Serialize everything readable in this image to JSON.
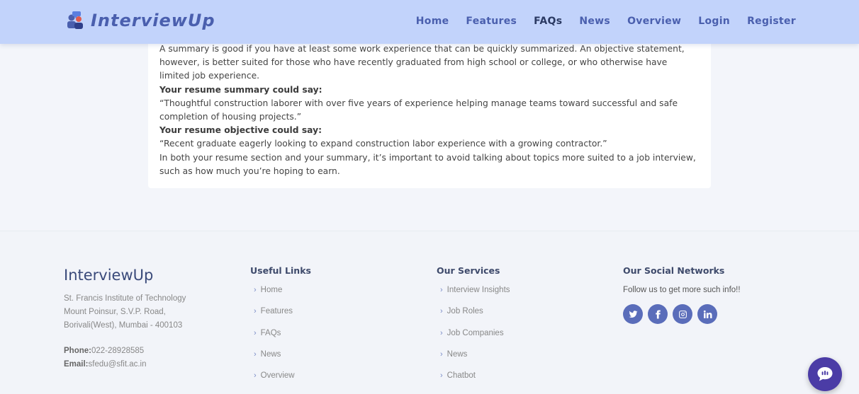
{
  "brand": {
    "name": "InterviewUp"
  },
  "nav": {
    "items": [
      {
        "label": "Home"
      },
      {
        "label": "Features"
      },
      {
        "label": "FAQs"
      },
      {
        "label": "News"
      },
      {
        "label": "Overview"
      },
      {
        "label": "Login"
      },
      {
        "label": "Register"
      }
    ],
    "active": "FAQs"
  },
  "content": {
    "paragraphs": [
      "A summary is good if you have at least some work experience that can be quickly summarized. An objective statement, however, is better suited for those who have recently graduated from high school or college, or who otherwise have limited job experience.",
      "Your resume summary could say:",
      "“Thoughtful construction laborer with over five years of experience helping manage teams toward successful and safe completion of housing projects.”",
      "Your resume objective could say:",
      "“Recent graduate eagerly looking to expand construction labor experience with a growing contractor.”",
      "In both your resume section and your summary, it’s important to avoid talking about topics more suited to a job interview, such as how much you’re hoping to earn."
    ]
  },
  "footer": {
    "brand": "InterviewUp",
    "address": [
      "St. Francis Institute of Technology",
      "Mount Poinsur, S.V.P. Road,",
      "Borivali(West), Mumbai - 400103"
    ],
    "phone_label": "Phone:",
    "phone": "022-28928585",
    "email_label": "Email:",
    "email": "sfedu@sfit.ac.in",
    "useful_links": {
      "title": "Useful Links",
      "items": [
        "Home",
        "Features",
        "FAQs",
        "News",
        "Overview"
      ]
    },
    "services": {
      "title": "Our Services",
      "items": [
        "Interview Insights",
        "Job Roles",
        "Job Companies",
        "News",
        "Chatbot"
      ]
    },
    "social": {
      "title": "Our Social Networks",
      "text": "Follow us to get more such info!!",
      "icons": [
        "twitter-icon",
        "facebook-icon",
        "instagram-icon",
        "linkedin-icon"
      ]
    }
  },
  "colors": {
    "header_bg": "#c2d3fb",
    "accent": "#4a5fae",
    "social_bg": "#5a6dba",
    "chat_bg": "#4b3ca6"
  }
}
